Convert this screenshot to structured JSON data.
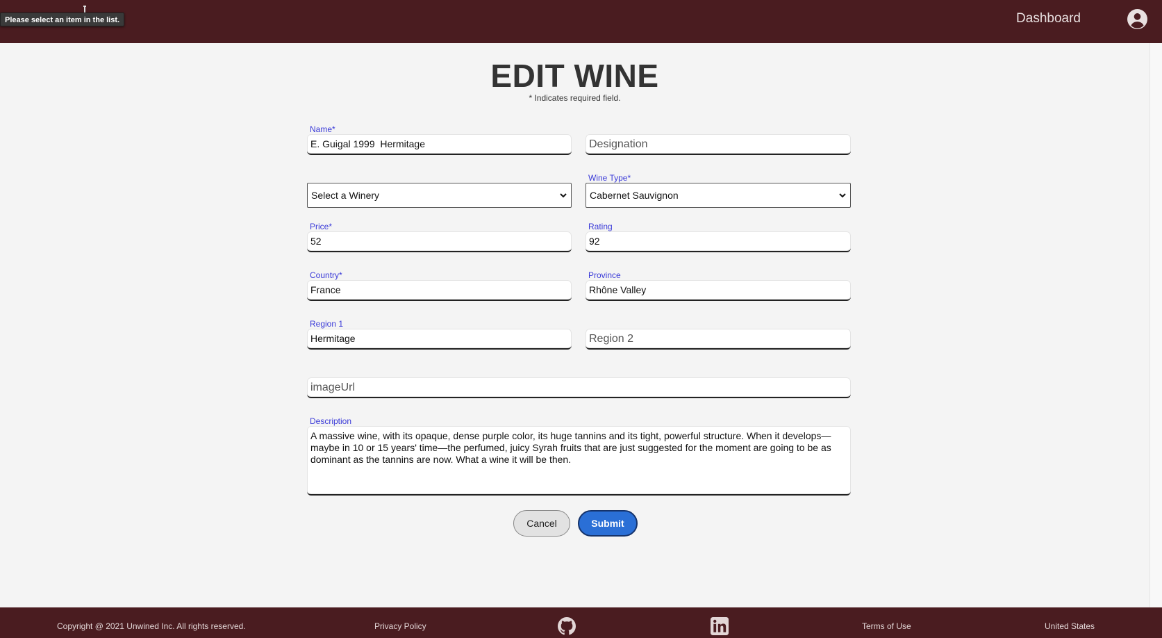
{
  "header": {
    "tooltip": "Please select an item in the list.",
    "dashboard_link": "Dashboard",
    "account_icon": "account-circle-icon"
  },
  "page": {
    "title": "EDIT WINE",
    "required_note": "* Indicates required field."
  },
  "form": {
    "name": {
      "label": "Name*",
      "value": "E. Guigal 1999  Hermitage"
    },
    "designation": {
      "placeholder": "Designation",
      "value": ""
    },
    "winery": {
      "selected": "Select a Winery"
    },
    "wine_type": {
      "label": "Wine Type*",
      "selected": "Cabernet Sauvignon"
    },
    "price": {
      "label": "Price*",
      "value": "52"
    },
    "rating": {
      "label": "Rating",
      "value": "92"
    },
    "country": {
      "label": "Country*",
      "value": "France"
    },
    "province": {
      "label": "Province",
      "value": "Rhône Valley"
    },
    "region1": {
      "label": "Region 1",
      "value": "Hermitage"
    },
    "region2": {
      "placeholder": "Region 2",
      "value": ""
    },
    "image_url": {
      "placeholder": "imageUrl",
      "value": ""
    },
    "description": {
      "label": "Description",
      "value": "A massive wine, with its opaque, dense purple color, its huge tannins and its tight, powerful structure. When it develops—maybe in 10 or 15 years' time—the perfumed, juicy Syrah fruits that are just suggested for the moment are going to be as dominant as the tannins are now. What a wine it will be then."
    },
    "cancel_label": "Cancel",
    "submit_label": "Submit"
  },
  "footer": {
    "copyright": "Copyright @ 2021 Unwined Inc. All rights reserved.",
    "privacy": "Privacy Policy",
    "github_icon": "github-icon",
    "linkedin_icon": "linkedin-icon",
    "terms": "Terms of Use",
    "country": "United States"
  }
}
